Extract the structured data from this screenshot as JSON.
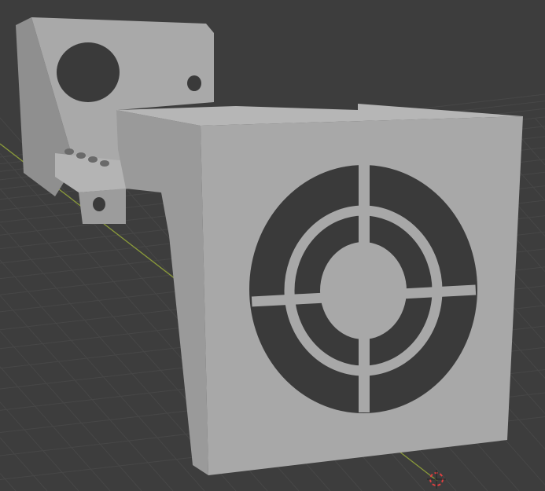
{
  "viewport": {
    "background_color": "#3d3d3d",
    "grid_color": "#474747",
    "y_axis_color": "#8a9a3a",
    "model_color": "#a8a8a8"
  },
  "icons": {
    "cursor": "3d-cursor-icon"
  }
}
